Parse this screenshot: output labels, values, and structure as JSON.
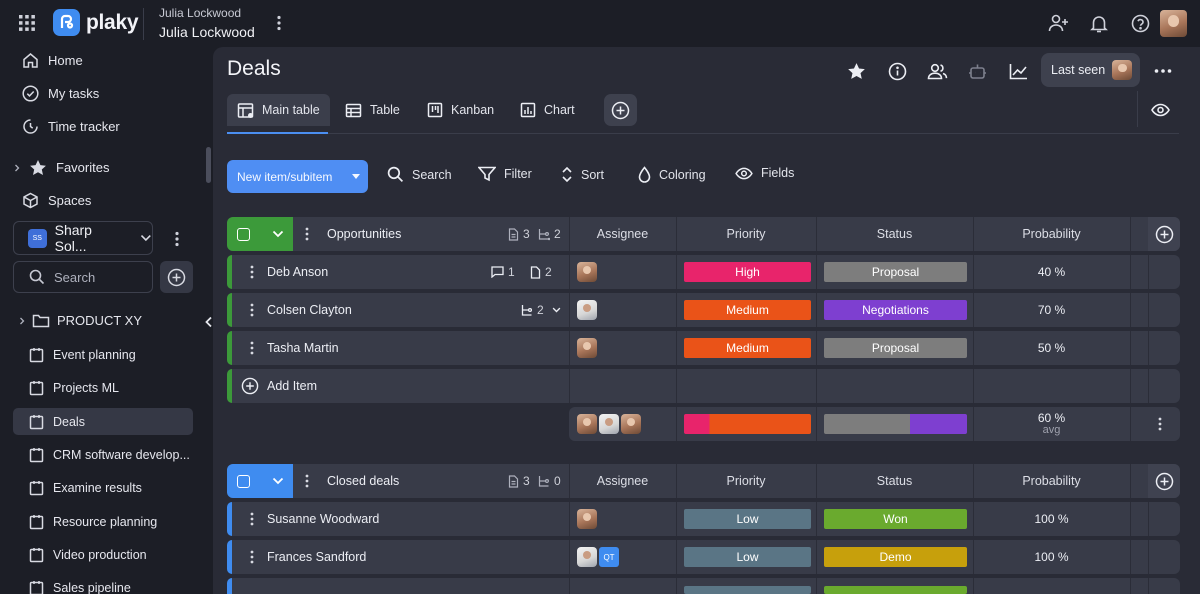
{
  "topbar": {
    "logo_text": "plaky",
    "workspace_owner": "Julia Lockwood",
    "workspace_name": "Julia Lockwood"
  },
  "sidebar": {
    "nav": [
      {
        "label": "Home",
        "icon": "home-icon"
      },
      {
        "label": "My tasks",
        "icon": "check-circle-icon"
      },
      {
        "label": "Time tracker",
        "icon": "timer-icon"
      },
      {
        "label": "Favorites",
        "icon": "star-icon"
      },
      {
        "label": "Spaces",
        "icon": "cube-icon"
      }
    ],
    "space_name": "Sharp Sol...",
    "space_badge": "SS",
    "search_placeholder": "Search",
    "folder": "PRODUCT XY",
    "boards": [
      "Event planning",
      "Projects ML",
      "Deals",
      "CRM software develop...",
      "Examine results",
      "Resource planning",
      "Video production",
      "Sales pipeline"
    ],
    "active_board": "Deals"
  },
  "header": {
    "title": "Deals",
    "last_seen_label": "Last seen"
  },
  "tabs": [
    {
      "label": "Main table",
      "active": true
    },
    {
      "label": "Table",
      "active": false
    },
    {
      "label": "Kanban",
      "active": false
    },
    {
      "label": "Chart",
      "active": false
    }
  ],
  "toolbar": {
    "new_item": "New item/subitem",
    "search": "Search",
    "filter": "Filter",
    "sort": "Sort",
    "coloring": "Coloring",
    "fields": "Fields"
  },
  "columns": {
    "assignee": "Assignee",
    "priority": "Priority",
    "status": "Status",
    "probability": "Probability"
  },
  "colors": {
    "high": "#e8246b",
    "medium": "#ea5318",
    "low": "#5a7585",
    "proposal": "#7d7d7d",
    "negotiations": "#7e3fd0",
    "won": "#6aaa2e",
    "demo": "#c7a00c",
    "group_green": "#3c9a3a",
    "group_blue": "#3f8cf0"
  },
  "groups": [
    {
      "name": "Opportunities",
      "doc_count": "3",
      "sub_count": "2",
      "rows": [
        {
          "name": "Deb Anson",
          "comments": "1",
          "files": "2",
          "priority": "High",
          "status": "Proposal",
          "probability": "40 %"
        },
        {
          "name": "Colsen Clayton",
          "subitems": "2",
          "priority": "Medium",
          "status": "Negotiations",
          "probability": "70 %"
        },
        {
          "name": "Tasha Martin",
          "priority": "Medium",
          "status": "Proposal",
          "probability": "50 %"
        }
      ],
      "add_item": "Add Item",
      "summary": {
        "probability": "60 %",
        "probability_label": "avg"
      }
    },
    {
      "name": "Closed deals",
      "doc_count": "3",
      "sub_count": "0",
      "rows": [
        {
          "name": "Susanne Woodward",
          "priority": "Low",
          "status": "Won",
          "probability": "100 %"
        },
        {
          "name": "Frances Sandford",
          "assignee_badge": "QT",
          "priority": "Low",
          "status": "Demo",
          "probability": "100 %"
        }
      ]
    }
  ]
}
